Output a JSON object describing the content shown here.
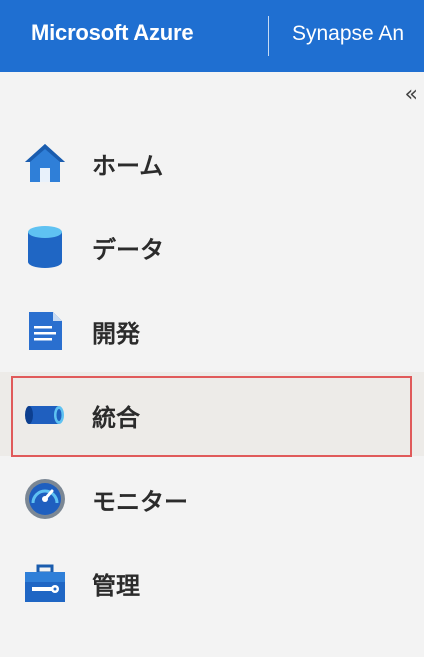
{
  "header": {
    "brand": "Microsoft Azure",
    "product": "Synapse An"
  },
  "sidebar": {
    "collapse_glyph": "«",
    "items": [
      {
        "label": "ホーム",
        "icon": "home-icon"
      },
      {
        "label": "データ",
        "icon": "data-cylinder-icon"
      },
      {
        "label": "開発",
        "icon": "develop-document-icon"
      },
      {
        "label": "統合",
        "icon": "integrate-pipeline-icon",
        "selected": true
      },
      {
        "label": "モニター",
        "icon": "monitor-gauge-icon"
      },
      {
        "label": "管理",
        "icon": "manage-toolbox-icon"
      }
    ]
  },
  "colors": {
    "header_bg": "#1f6fd1",
    "selected_bg": "#edebe8",
    "highlight_border": "#e05a5a",
    "icon_blue": "#1f6fd1"
  }
}
